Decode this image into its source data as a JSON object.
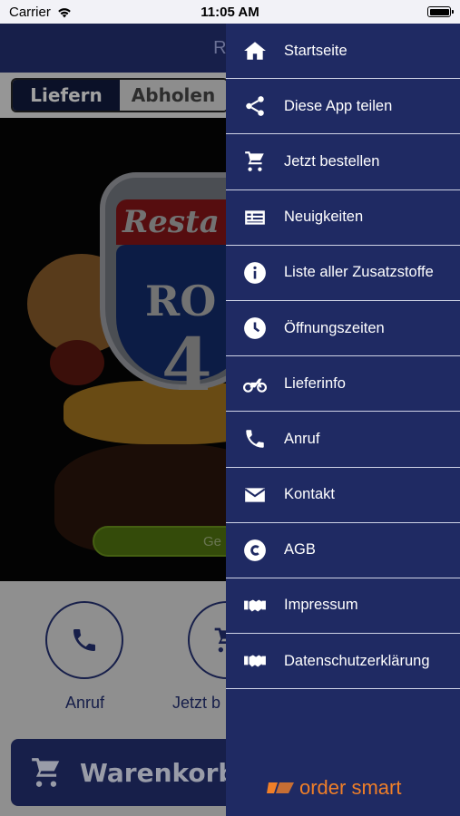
{
  "status_bar": {
    "carrier": "Carrier",
    "time": "11:05 AM"
  },
  "navbar": {
    "title_partial": "Rou"
  },
  "segment": {
    "deliver": "Liefern",
    "pickup": "Abholen"
  },
  "hero": {
    "logo_text_top": "Resta",
    "logo_text_mid": "RO",
    "logo_text_num": "4",
    "status_button_partial": "Ge"
  },
  "actions": {
    "call_label": "Anruf",
    "order_label_partial": "Jetzt b"
  },
  "cart": {
    "label": "Warenkorb"
  },
  "drawer": {
    "items": [
      {
        "label": "Startseite",
        "icon": "home-icon"
      },
      {
        "label": "Diese App teilen",
        "icon": "share-icon"
      },
      {
        "label": "Jetzt bestellen",
        "icon": "cart-icon"
      },
      {
        "label": "Neuigkeiten",
        "icon": "news-icon"
      },
      {
        "label": "Liste aller Zusatzstoffe",
        "icon": "info-icon"
      },
      {
        "label": "Öffnungszeiten",
        "icon": "clock-icon"
      },
      {
        "label": "Lieferinfo",
        "icon": "motorcycle-icon"
      },
      {
        "label": "Anruf",
        "icon": "phone-icon"
      },
      {
        "label": "Kontakt",
        "icon": "envelope-icon"
      },
      {
        "label": "AGB",
        "icon": "copyright-icon"
      },
      {
        "label": "Impressum",
        "icon": "handshake-icon"
      },
      {
        "label": "Datenschutzerklärung",
        "icon": "handshake-icon"
      }
    ],
    "brand": "order smart"
  },
  "colors": {
    "primary": "#1f2a63",
    "accent": "#f07f28",
    "green": "#6c9b16"
  }
}
